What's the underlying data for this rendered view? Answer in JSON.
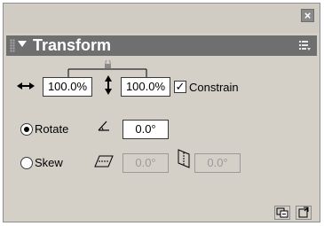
{
  "window": {
    "close_glyph": "×"
  },
  "panel": {
    "title": "Transform",
    "icons": {
      "collapse": "triangle-down-icon",
      "options": "panel-options-icon",
      "grip": "grip-icon"
    }
  },
  "scale": {
    "width_value": "100.0%",
    "height_value": "100.0%",
    "constrain_label": "Constrain",
    "constrain_checked": true,
    "icons": {
      "width": "horizontal-scale-icon",
      "height": "vertical-scale-icon",
      "link": "lock-link-icon"
    }
  },
  "rotate": {
    "label": "Rotate",
    "selected": true,
    "value": "0.0°",
    "icon": "rotate-angle-icon"
  },
  "skew": {
    "label": "Skew",
    "selected": false,
    "horizontal_value": "0.0°",
    "vertical_value": "0.0°",
    "icons": {
      "horizontal": "skew-horizontal-icon",
      "vertical": "skew-vertical-icon"
    }
  },
  "footer": {
    "icons": {
      "copy_transform": "copy-and-apply-transform-icon",
      "reset": "reset-transform-icon"
    }
  }
}
